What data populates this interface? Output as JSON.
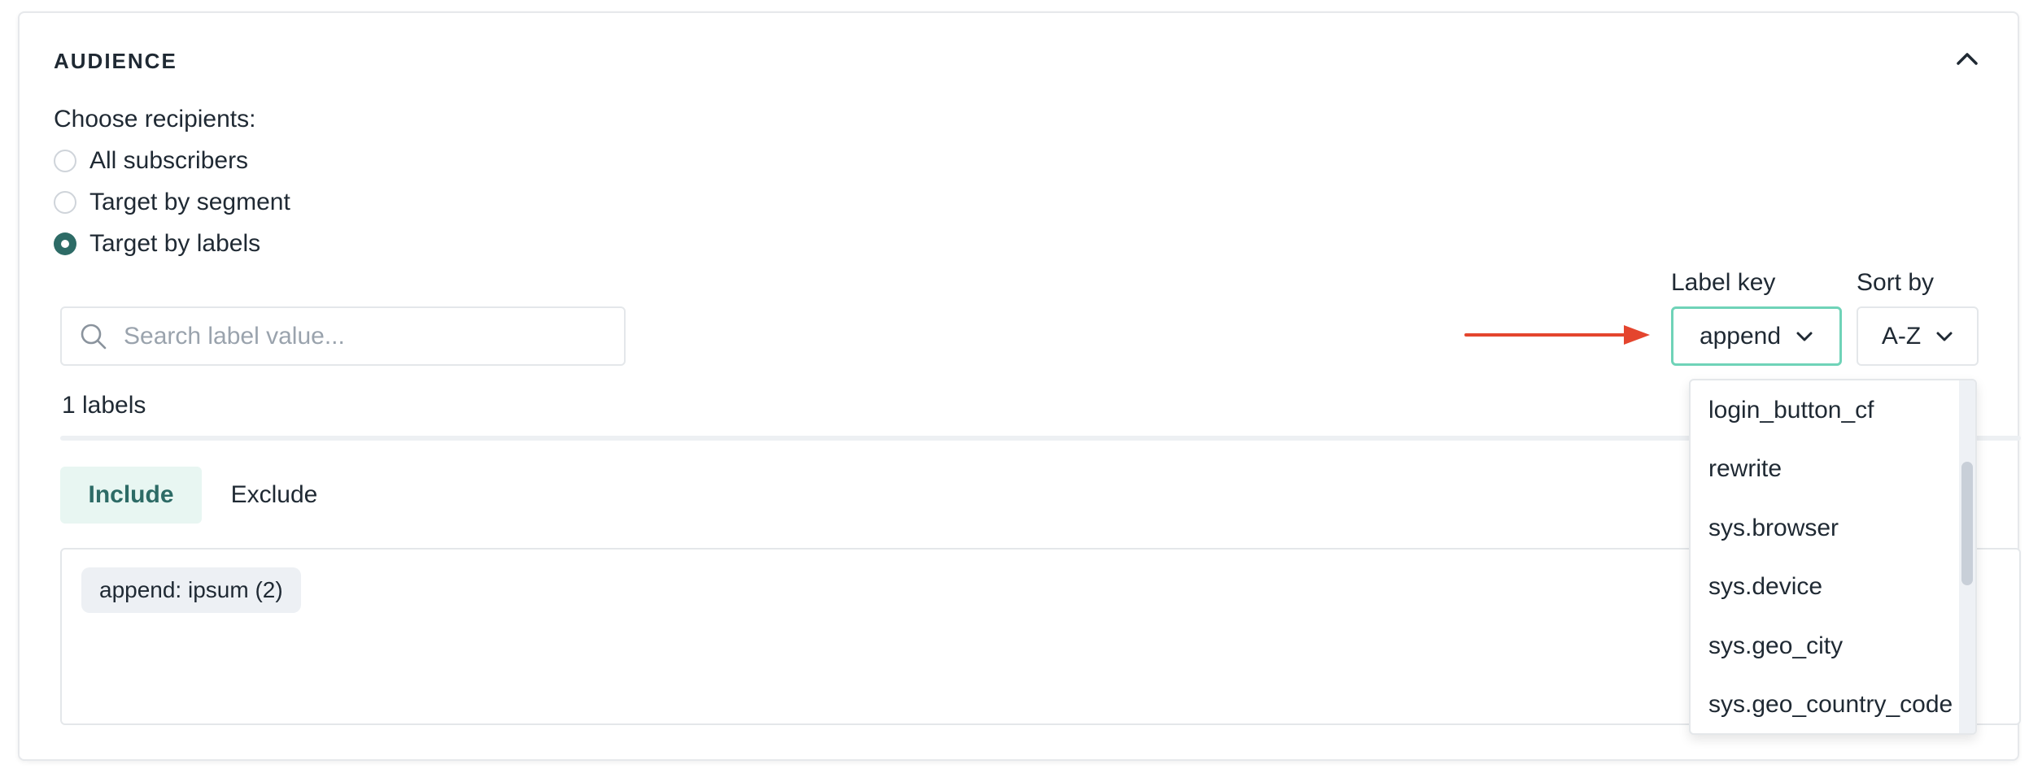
{
  "section": {
    "title": "AUDIENCE",
    "collapse_icon": "chevron-up-icon"
  },
  "recipients": {
    "label": "Choose recipients:",
    "options": [
      {
        "label": "All subscribers",
        "selected": false
      },
      {
        "label": "Target by segment",
        "selected": false
      },
      {
        "label": "Target by labels",
        "selected": true
      }
    ]
  },
  "search": {
    "placeholder": "Search label value...",
    "value": "",
    "icon": "search-icon"
  },
  "label_key": {
    "label": "Label key",
    "value": "append",
    "options": [
      "login_button_cf",
      "rewrite",
      "sys.browser",
      "sys.device",
      "sys.geo_city",
      "sys.geo_country_code"
    ]
  },
  "sort_by": {
    "label": "Sort by",
    "value": "A-Z"
  },
  "labels_count": "1 labels",
  "tabs": [
    {
      "label": "Include",
      "active": true
    },
    {
      "label": "Exclude",
      "active": false
    }
  ],
  "selected_labels": [
    {
      "text": "append: ipsum (2)"
    }
  ],
  "colors": {
    "accent": "#2d6b66",
    "accent_bg": "#e8f6f2",
    "select_border_active": "#6fd3b8",
    "annotation_arrow": "#e4452e"
  }
}
